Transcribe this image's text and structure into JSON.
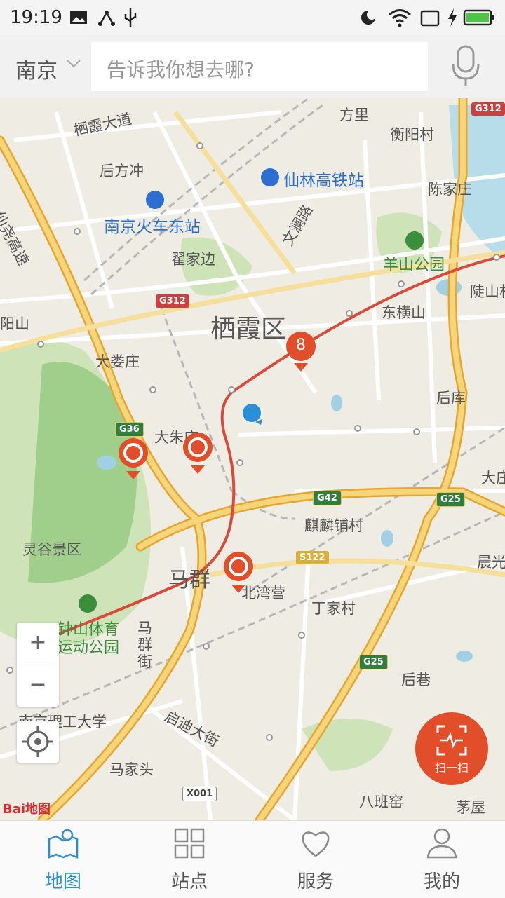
{
  "status_bar": {
    "time": "19:19"
  },
  "search": {
    "city": "南京",
    "placeholder": "告诉我你想去哪?"
  },
  "map": {
    "district_label": "栖霞区",
    "cluster_count": "8",
    "stations": {
      "xianlin": "仙林高铁站",
      "nanjing_east": "南京火车东站"
    },
    "parks": {
      "yangshan": "羊山公园",
      "zhongshan_1": "钟山体育",
      "zhongshan_2": "运动公园",
      "njust": "南京理工大学"
    },
    "places": [
      "方里",
      "栖霞大道",
      "衡阳村",
      "后方冲",
      "陈家庄",
      "翟家边",
      "文澜路",
      "东横山",
      "陡山村",
      "大娄庄",
      "后库",
      "大朱庄",
      "大庄",
      "麒麟铺村",
      "灵谷景区",
      "晨光",
      "马群",
      "北湾营",
      "丁家村",
      "马群街",
      "后巷",
      "启迪大街",
      "马家头",
      "八班窑",
      "茅屋",
      "阳山",
      "仙尧高速"
    ],
    "roads": [
      "G312",
      "G312",
      "G36",
      "G42",
      "G25",
      "G25",
      "S122",
      "X001"
    ],
    "brand": "Bai地图"
  },
  "controls": {
    "zoom_in": "+",
    "zoom_out": "−",
    "scan_label": "扫一扫"
  },
  "tabs": [
    {
      "label": "地图",
      "active": true
    },
    {
      "label": "站点",
      "active": false
    },
    {
      "label": "服务",
      "active": false
    },
    {
      "label": "我的",
      "active": false
    }
  ],
  "colors": {
    "accent": "#2a8fd6",
    "marker": "#e24d2a",
    "expressway": "#f2b93b",
    "metro": "#d94a3a"
  }
}
